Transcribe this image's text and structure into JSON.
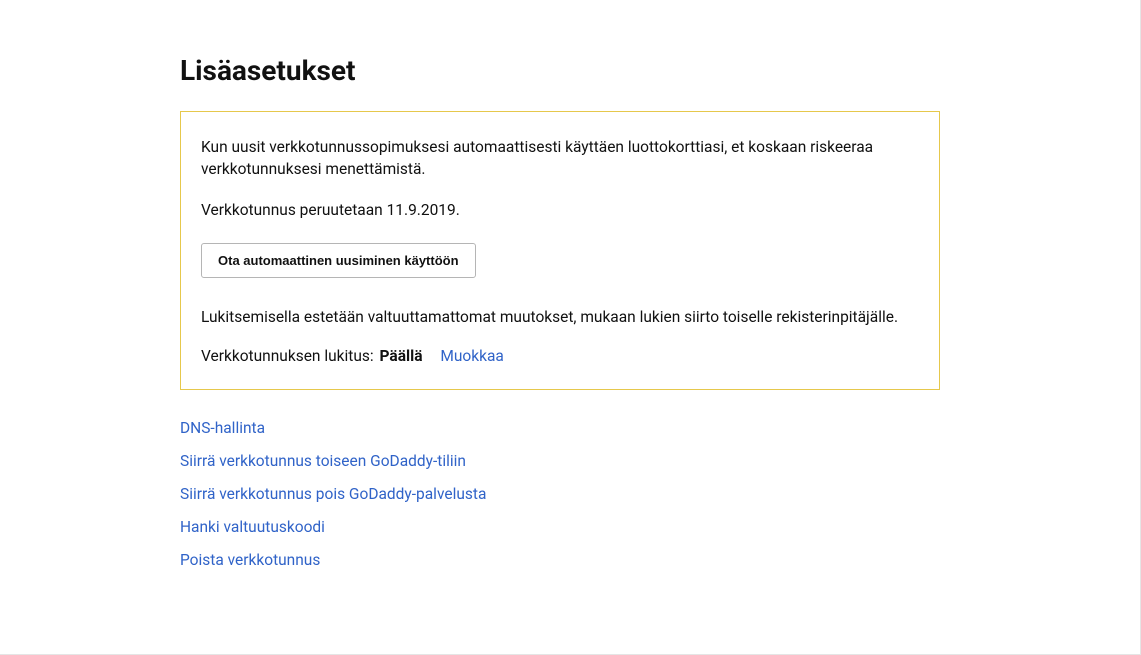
{
  "title": "Lisäasetukset",
  "notice": {
    "line1": "Kun uusit verkkotunnussopimuksesi automaattisesti käyttäen luottokorttiasi, et koskaan riskeeraa verkkotunnuksesi menettämistä.",
    "line2": "Verkkotunnus peruutetaan 11.9.2019.",
    "button": "Ota automaattinen uusiminen käyttöön",
    "lock_desc": "Lukitsemisella estetään valtuuttamattomat muutokset, mukaan lukien siirto toiselle rekisterinpitäjälle.",
    "lock_label": "Verkkotunnuksen lukitus:",
    "lock_status": "Päällä",
    "edit_link": "Muokkaa"
  },
  "links": [
    "DNS-hallinta",
    "Siirrä verkkotunnus toiseen GoDaddy-tiliin",
    "Siirrä verkkotunnus pois GoDaddy-palvelusta",
    "Hanki valtuutuskoodi",
    "Poista verkkotunnus"
  ]
}
